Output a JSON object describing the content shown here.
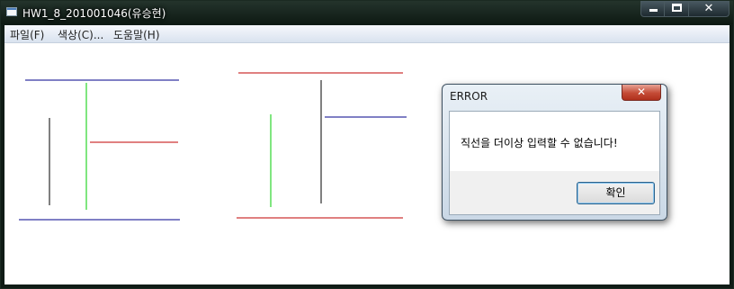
{
  "window": {
    "title": "HW1_8_201001046(유승현)",
    "icon": "app-window-icon"
  },
  "caption_buttons": {
    "minimize_icon": "minimize-icon",
    "maximize_icon": "maximize-icon",
    "close_glyph": "✕"
  },
  "menu": {
    "items": [
      {
        "label": "파일(F)"
      },
      {
        "label": "색상(C)..."
      },
      {
        "label": "도움말(H)"
      }
    ]
  },
  "canvas": {
    "background": "#ffffff",
    "line_colors": {
      "blue": "#00008b",
      "red": "#c00000",
      "green": "#00cc00",
      "black": "#000000"
    }
  },
  "dialog": {
    "title": "ERROR",
    "close_glyph": "✕",
    "message": "직선을 더이상 입력할 수 없습니다!",
    "ok_label": "확인"
  }
}
